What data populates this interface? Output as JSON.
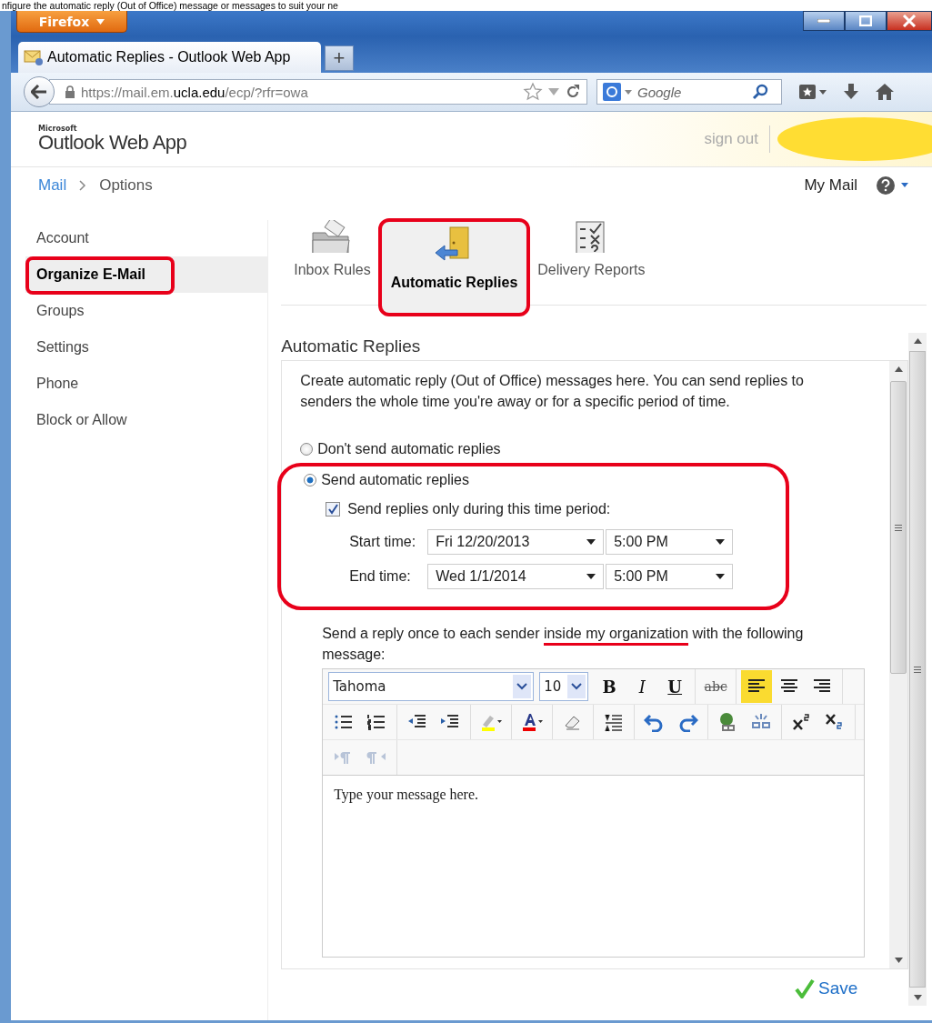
{
  "caption": "nfigure the automatic reply (Out of Office) message or messages to suit your ne",
  "browser": {
    "menu_button": "Firefox",
    "tab_title": "Automatic Replies - Outlook Web App",
    "new_tab": "+",
    "url": {
      "before": "https://mail.em.",
      "host": "ucla.edu",
      "after": "/ecp/?rfr=owa"
    },
    "search": {
      "placeholder": "Google"
    }
  },
  "header": {
    "logo_small": "Microsoft",
    "logo": "Outlook Web App",
    "sign_out": "sign out"
  },
  "breadcrumb": {
    "items": [
      "Mail",
      "Options"
    ],
    "my_mail": "My Mail"
  },
  "sidebar": {
    "items": [
      {
        "label": "Account",
        "selected": false,
        "highlighted": false
      },
      {
        "label": "Organize E-Mail",
        "selected": true,
        "highlighted": true
      },
      {
        "label": "Groups",
        "selected": false,
        "highlighted": false
      },
      {
        "label": "Settings",
        "selected": false,
        "highlighted": false
      },
      {
        "label": "Phone",
        "selected": false,
        "highlighted": false
      },
      {
        "label": "Block or Allow",
        "selected": false,
        "highlighted": false
      }
    ]
  },
  "option_tabs": [
    {
      "kind": "rules",
      "label": "Inbox Rules",
      "selected": false,
      "highlighted": false
    },
    {
      "kind": "replies",
      "label": "Automatic Replies",
      "selected": true,
      "highlighted": true
    },
    {
      "kind": "reports",
      "label": "Delivery Reports",
      "selected": false,
      "highlighted": false
    }
  ],
  "section": {
    "title": "Automatic Replies",
    "intro": "Create automatic reply (Out of Office) messages here. You can send replies to senders the whole time you're away or for a specific period of time.",
    "radios": [
      {
        "label": "Don't send automatic replies",
        "selected": false
      },
      {
        "label": "Send automatic replies",
        "selected": true
      }
    ],
    "group_highlighted": true,
    "period": {
      "label": "Send replies only during this time period:",
      "checked": true
    },
    "times": [
      {
        "label": "Start time:",
        "date": "Fri 12/20/2013",
        "time": "5:00 PM"
      },
      {
        "label": "End time:",
        "date": "Wed 1/1/2014",
        "time": "5:00 PM"
      }
    ],
    "prompt": {
      "before": "Send a reply once to each sender ",
      "underlined": "inside my organization",
      "after": " with the following message:"
    },
    "editor": {
      "font": "Tahoma",
      "size": "10",
      "rows": [
        [
          {
            "kind": "bold",
            "label": "B",
            "selected": false
          },
          {
            "kind": "italic",
            "label": "I",
            "selected": false
          },
          {
            "kind": "underline",
            "label": "U",
            "selected": false
          },
          {
            "kind": "sep"
          },
          {
            "kind": "strike",
            "label": "abc",
            "selected": false
          },
          {
            "kind": "sep"
          },
          {
            "kind": "align-left",
            "selected": true
          },
          {
            "kind": "align-center",
            "selected": false
          },
          {
            "kind": "align-right",
            "selected": false
          },
          {
            "kind": "sep"
          }
        ],
        [
          {
            "kind": "bullets",
            "selected": false
          },
          {
            "kind": "numbering",
            "selected": false
          },
          {
            "kind": "sep"
          },
          {
            "kind": "outdent",
            "selected": false
          },
          {
            "kind": "indent",
            "selected": false
          },
          {
            "kind": "sep"
          },
          {
            "kind": "highlight",
            "selected": false
          },
          {
            "kind": "sep"
          },
          {
            "kind": "font-color",
            "selected": false
          },
          {
            "kind": "sep"
          },
          {
            "kind": "eraser",
            "selected": false
          },
          {
            "kind": "sep"
          },
          {
            "kind": "spacing",
            "selected": false
          },
          {
            "kind": "sep"
          },
          {
            "kind": "undo",
            "selected": false
          },
          {
            "kind": "redo",
            "selected": false
          },
          {
            "kind": "sep"
          },
          {
            "kind": "link",
            "selected": false
          },
          {
            "kind": "unlink",
            "selected": false
          },
          {
            "kind": "sep"
          },
          {
            "kind": "superscript",
            "selected": false
          },
          {
            "kind": "subscript",
            "selected": false
          },
          {
            "kind": "sep"
          }
        ],
        [
          {
            "kind": "ltr",
            "selected": false
          },
          {
            "kind": "rtl",
            "selected": false
          },
          {
            "kind": "sep"
          }
        ]
      ],
      "body": "Type your message here."
    },
    "save": "Save"
  }
}
